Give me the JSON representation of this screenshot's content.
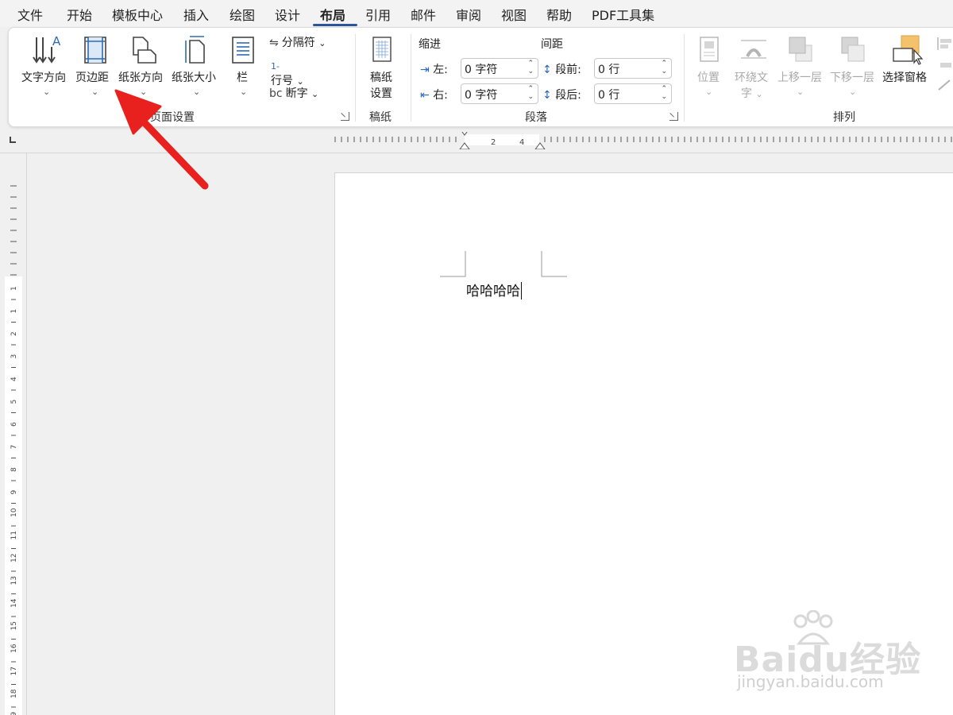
{
  "menu": {
    "tabs": [
      "文件",
      "开始",
      "模板中心",
      "插入",
      "绘图",
      "设计",
      "布局",
      "引用",
      "邮件",
      "审阅",
      "视图",
      "帮助",
      "PDF工具集"
    ],
    "active_tab": "布局"
  },
  "ribbon": {
    "page_setup": {
      "text_direction": "文字方向",
      "margins": "页边距",
      "orientation": "纸张方向",
      "size": "纸张大小",
      "columns": "栏",
      "breaks": "分隔符",
      "line_numbers": "行号",
      "hyphenation": "断字",
      "group_label": "页面设置"
    },
    "manuscript": {
      "settings_line1": "稿纸",
      "settings_line2": "设置",
      "group_label": "稿纸"
    },
    "paragraph": {
      "indent_label": "缩进",
      "spacing_label": "间距",
      "left_label": "左:",
      "left_value": "0 字符",
      "right_label": "右:",
      "right_value": "0 字符",
      "before_label": "段前:",
      "before_value": "0 行",
      "after_label": "段后:",
      "after_value": "0 行",
      "group_label": "段落"
    },
    "arrange": {
      "position": "位置",
      "wrap_text_line1": "环绕文",
      "wrap_text_line2": "字",
      "bring_forward": "上移一层",
      "send_backward": "下移一层",
      "selection_pane": "选择窗格",
      "group_label": "排列"
    }
  },
  "ruler": {
    "h_labels": [
      "2",
      "4"
    ],
    "v_labels": [
      "1",
      "1",
      "2",
      "3",
      "4",
      "5",
      "6",
      "7",
      "8",
      "9",
      "10",
      "11",
      "12",
      "13",
      "14",
      "15",
      "16",
      "17",
      "18",
      "19"
    ]
  },
  "document": {
    "text": "哈哈哈哈"
  },
  "watermark": {
    "main": "Baidu经验",
    "sub": "jingyan.baidu.com"
  },
  "colors": {
    "accent": "#2b579a",
    "arrow": "#e8211f",
    "icon_blue": "#2e6ab5"
  }
}
